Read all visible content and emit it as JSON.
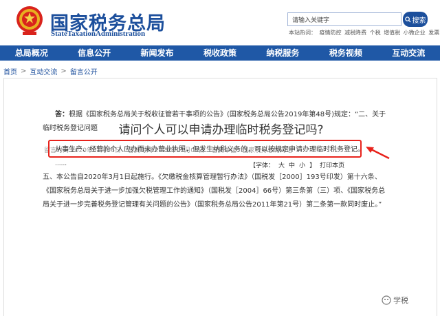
{
  "header": {
    "title": "国家税务总局",
    "subtitle": "StateTaxationAdministration",
    "search_placeholder": "请输入关键字",
    "search_button": "搜索",
    "hotwords_label": "本站热词：",
    "hotwords": [
      "疫情防控",
      "减税降费",
      "个税",
      "增值税",
      "小微企业",
      "发票"
    ]
  },
  "nav": {
    "items": [
      "总局概况",
      "信息公开",
      "新闻发布",
      "税收政策",
      "纳税服务",
      "税务视频",
      "互动交流"
    ]
  },
  "breadcrumb": {
    "items": [
      "首页",
      "互动交流",
      "留言公开"
    ],
    "separator": ">"
  },
  "article": {
    "title": "请问个人可以申请办理临时税务登记吗?",
    "meta": {
      "message_time": "留言时间:2020年01月06日",
      "reply_time": "答复时间:2020年01月08日",
      "replier": "答复单位：国家税务总局网站"
    },
    "tools": {
      "font_label": "【字体：",
      "sizes": [
        "大",
        "中",
        "小"
      ],
      "font_close": "】",
      "print": "打印本页"
    },
    "answer_label": "答：",
    "p1": "根据《国家税务总局关于税收征管若干事项的公告》(国家税务总局公告2019年第48号)规定：“二、关于临时税务登记问题",
    "highlight": "从事生产、经营的个人应办而未办营业执照，但发生纳税义务的，可以按规定申请办理临时税务登记。",
    "dots": "......",
    "p2": "五、本公告自2020年3月1日起施行。《欠缴税金核算管理暂行办法》（国税发［2000］193号印发）第十六条、《国家税务总局关于进一步加强欠税管理工作的通知》（国税发［2004］66号）第三条第（三）项、《国家税务总局关于进一步完善税务登记管理有关问题的公告》（国家税务总局公告2011年第21号）第二条第一款同时废止。”"
  },
  "watermark": "学税",
  "colors": {
    "brand": "#1c4f9c",
    "nav_bg": "#1f58a6",
    "highlight": "#e8221b"
  }
}
